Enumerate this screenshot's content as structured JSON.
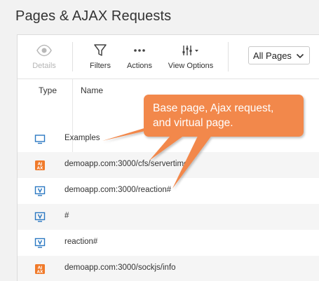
{
  "page": {
    "title": "Pages & AJAX Requests"
  },
  "toolbar": {
    "details_label": "Details",
    "filters_label": "Filters",
    "actions_label": "Actions",
    "view_options_label": "View Options",
    "select_value": "All Pages"
  },
  "table": {
    "columns": [
      "Type",
      "Name"
    ],
    "rows": [
      {
        "type": "base-page",
        "icon": "monitor-icon",
        "name": "Examples"
      },
      {
        "type": "ajax-request",
        "icon": "ajax-icon",
        "name": "demoapp.com:3000/cfs/servertime"
      },
      {
        "type": "virtual-page",
        "icon": "virtual-page-icon",
        "name": "demoapp.com:3000/reaction#"
      },
      {
        "type": "virtual-page",
        "icon": "virtual-page-icon",
        "name": "#"
      },
      {
        "type": "virtual-page",
        "icon": "virtual-page-icon",
        "name": "reaction#"
      },
      {
        "type": "ajax-request",
        "icon": "ajax-icon",
        "name": "demoapp.com:3000/sockjs/info"
      }
    ]
  },
  "callout": {
    "line1": "Base page, Ajax request,",
    "line2": "and virtual page."
  },
  "colors": {
    "callout": "#f2884b",
    "icon_blue": "#2b78c2",
    "ajax_orange": "#f07a2a"
  }
}
